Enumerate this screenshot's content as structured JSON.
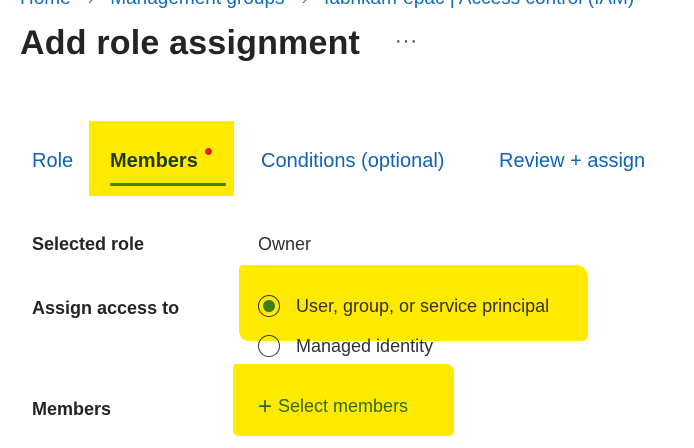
{
  "breadcrumb": {
    "items": [
      {
        "label": "Home"
      },
      {
        "label": "Management groups"
      },
      {
        "label": "fabrikam-epac | Access control (IAM)"
      }
    ],
    "separator": "›"
  },
  "header": {
    "title": "Add role assignment",
    "more_label": "···"
  },
  "tabs": [
    {
      "label": "Role",
      "selected": false
    },
    {
      "label": "Members",
      "selected": true,
      "has_indicator": true
    },
    {
      "label": "Conditions (optional)",
      "selected": false
    },
    {
      "label": "Review + assign",
      "selected": false
    }
  ],
  "form": {
    "selected_role": {
      "label": "Selected role",
      "value": "Owner"
    },
    "assign_access_to": {
      "label": "Assign access to",
      "options": [
        {
          "label": "User, group, or service principal",
          "selected": true
        },
        {
          "label": "Managed identity",
          "selected": false
        }
      ]
    },
    "members": {
      "label": "Members",
      "action_label": "Select members",
      "action_icon": "plus-icon"
    }
  },
  "colors": {
    "highlight": "#ffea00",
    "tab_link": "#1062b8",
    "active_accent": "#4d7a2a",
    "indicator_dot": "#e02020"
  }
}
